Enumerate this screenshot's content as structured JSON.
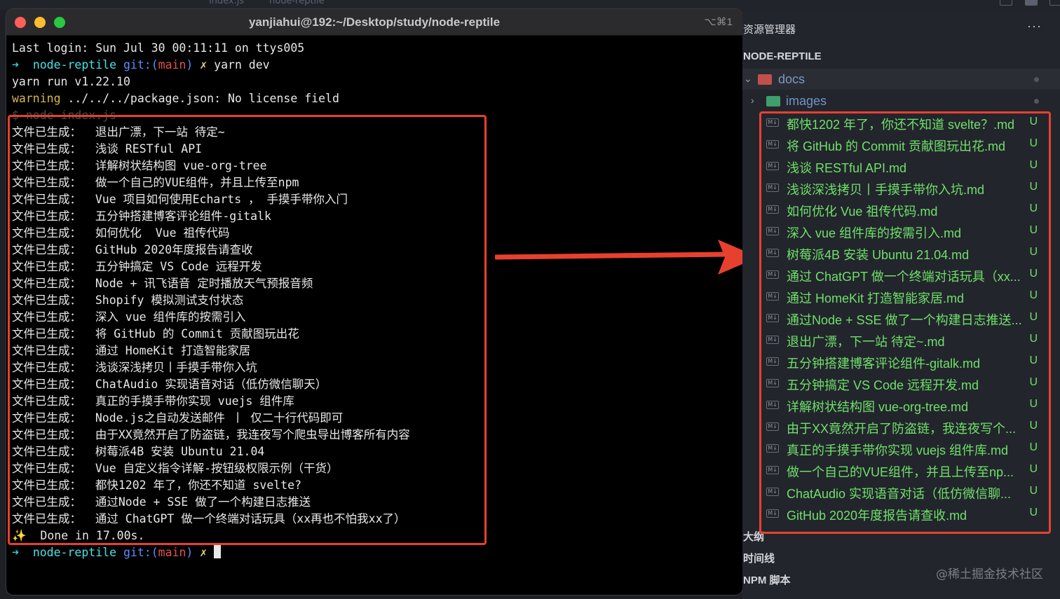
{
  "behind": {
    "tab_left": "index.js",
    "tab_right": "node-reptile"
  },
  "terminal": {
    "title": "yanjiahui@192:~/Desktop/study/node-reptile",
    "shortcut": "⌥⌘1",
    "last_login": "Last login: Sun Jul 30 00:11:11 on ttys005",
    "prompt": {
      "arrow": "➜",
      "dir": "node-reptile",
      "git_prefix": "git:(",
      "branch": "main",
      "git_suffix": ")",
      "dirty": "✗"
    },
    "command": "yarn dev",
    "yarn_run": "yarn run v1.22.10",
    "warning_label": "warning",
    "warning_text": " ../../../package.json: No license field",
    "node_cmd": "$ node index.js",
    "output_lines": [
      "文件已生成：  退出广漂，下一站 待定~",
      "文件已生成：  浅谈 RESTful API",
      "文件已生成：  详解树状结构图 vue-org-tree",
      "文件已生成：  做一个自己的VUE组件，并且上传至npm",
      "文件已生成：  Vue 项目如何使用Echarts ， 手摸手带你入门",
      "文件已生成：  五分钟搭建博客评论组件-gitalk",
      "文件已生成：  如何优化  Vue 祖传代码",
      "文件已生成：  GitHub 2020年度报告请查收",
      "文件已生成：  五分钟搞定 VS Code 远程开发",
      "文件已生成：  Node + 讯飞语音 定时播放天气预报音频",
      "文件已生成：  Shopify 模拟测试支付状态",
      "文件已生成：  深入 vue 组件库的按需引入",
      "文件已生成：  将 GitHub 的 Commit 贡献图玩出花",
      "文件已生成：  通过 HomeKit 打造智能家居",
      "文件已生成：  浅谈深浅拷贝丨手摸手带你入坑",
      "文件已生成：  ChatAudio 实现语音对话（低仿微信聊天）",
      "文件已生成：  真正的手摸手带你实现 vuejs 组件库",
      "文件已生成：  Node.js之自动发送邮件 丨 仅二十行代码即可",
      "文件已生成：  由于XX竟然开启了防盗链，我连夜写个爬虫导出博客所有内容",
      "文件已生成：  树莓派4B 安装 Ubuntu 21.04",
      "文件已生成：  Vue 自定义指令详解-按钮级权限示例（干货）",
      "文件已生成：  都快1202 年了，你还不知道 svelte?",
      "文件已生成：  通过Node + SSE 做了一个构建日志推送",
      "文件已生成：  通过 ChatGPT 做一个终端对话玩具（xx再也不怕我xx了）"
    ],
    "done_icon": "✨",
    "done_text": "  Done in 17.00s."
  },
  "explorer": {
    "header": "资源管理器",
    "more": "···",
    "project": "NODE-REPTILE",
    "folders": [
      {
        "name": "docs",
        "chevron": "⌄"
      },
      {
        "name": "images",
        "chevron": "›"
      }
    ],
    "files": [
      {
        "name": "都快1202 年了，你还不知道 svelte？.md",
        "status": "U"
      },
      {
        "name": "将 GitHub 的 Commit 贡献图玩出花.md",
        "status": "U"
      },
      {
        "name": "浅谈 RESTful API.md",
        "status": "U"
      },
      {
        "name": "浅谈深浅拷贝丨手摸手带你入坑.md",
        "status": "U"
      },
      {
        "name": "如何优化  Vue 祖传代码.md",
        "status": "U"
      },
      {
        "name": "深入 vue 组件库的按需引入.md",
        "status": "U"
      },
      {
        "name": "树莓派4B 安装 Ubuntu 21.04.md",
        "status": "U"
      },
      {
        "name": "通过 ChatGPT 做一个终端对话玩具（xx...",
        "status": "U"
      },
      {
        "name": "通过 HomeKit 打造智能家居.md",
        "status": "U"
      },
      {
        "name": "通过Node + SSE 做了一个构建日志推送...",
        "status": "U"
      },
      {
        "name": "退出广漂，下一站 待定~.md",
        "status": "U"
      },
      {
        "name": "五分钟搭建博客评论组件-gitalk.md",
        "status": "U"
      },
      {
        "name": "五分钟搞定 VS Code 远程开发.md",
        "status": "U"
      },
      {
        "name": "详解树状结构图 vue-org-tree.md",
        "status": "U"
      },
      {
        "name": "由于XX竟然开启了防盗链，我连夜写个...",
        "status": "U"
      },
      {
        "name": "真正的手摸手带你实现 vuejs 组件库.md",
        "status": "U"
      },
      {
        "name": "做一个自己的VUE组件，并且上传至np...",
        "status": "U"
      },
      {
        "name": "ChatAudio 实现语音对话（低仿微信聊...",
        "status": "U"
      },
      {
        "name": "GitHub 2020年度报告请查收.md",
        "status": "U"
      }
    ],
    "md_badge": "M↓",
    "sections": [
      "大纲",
      "时间线",
      "NPM 脚本"
    ]
  },
  "watermark": "@稀土掘金技术社区",
  "colors": {
    "terminal_bg": "#000000",
    "prompt_arrow": "#2fd0d3",
    "branch": "#e2534a",
    "untracked_file": "#6ee06a",
    "highlight_box": "#e8402f"
  }
}
